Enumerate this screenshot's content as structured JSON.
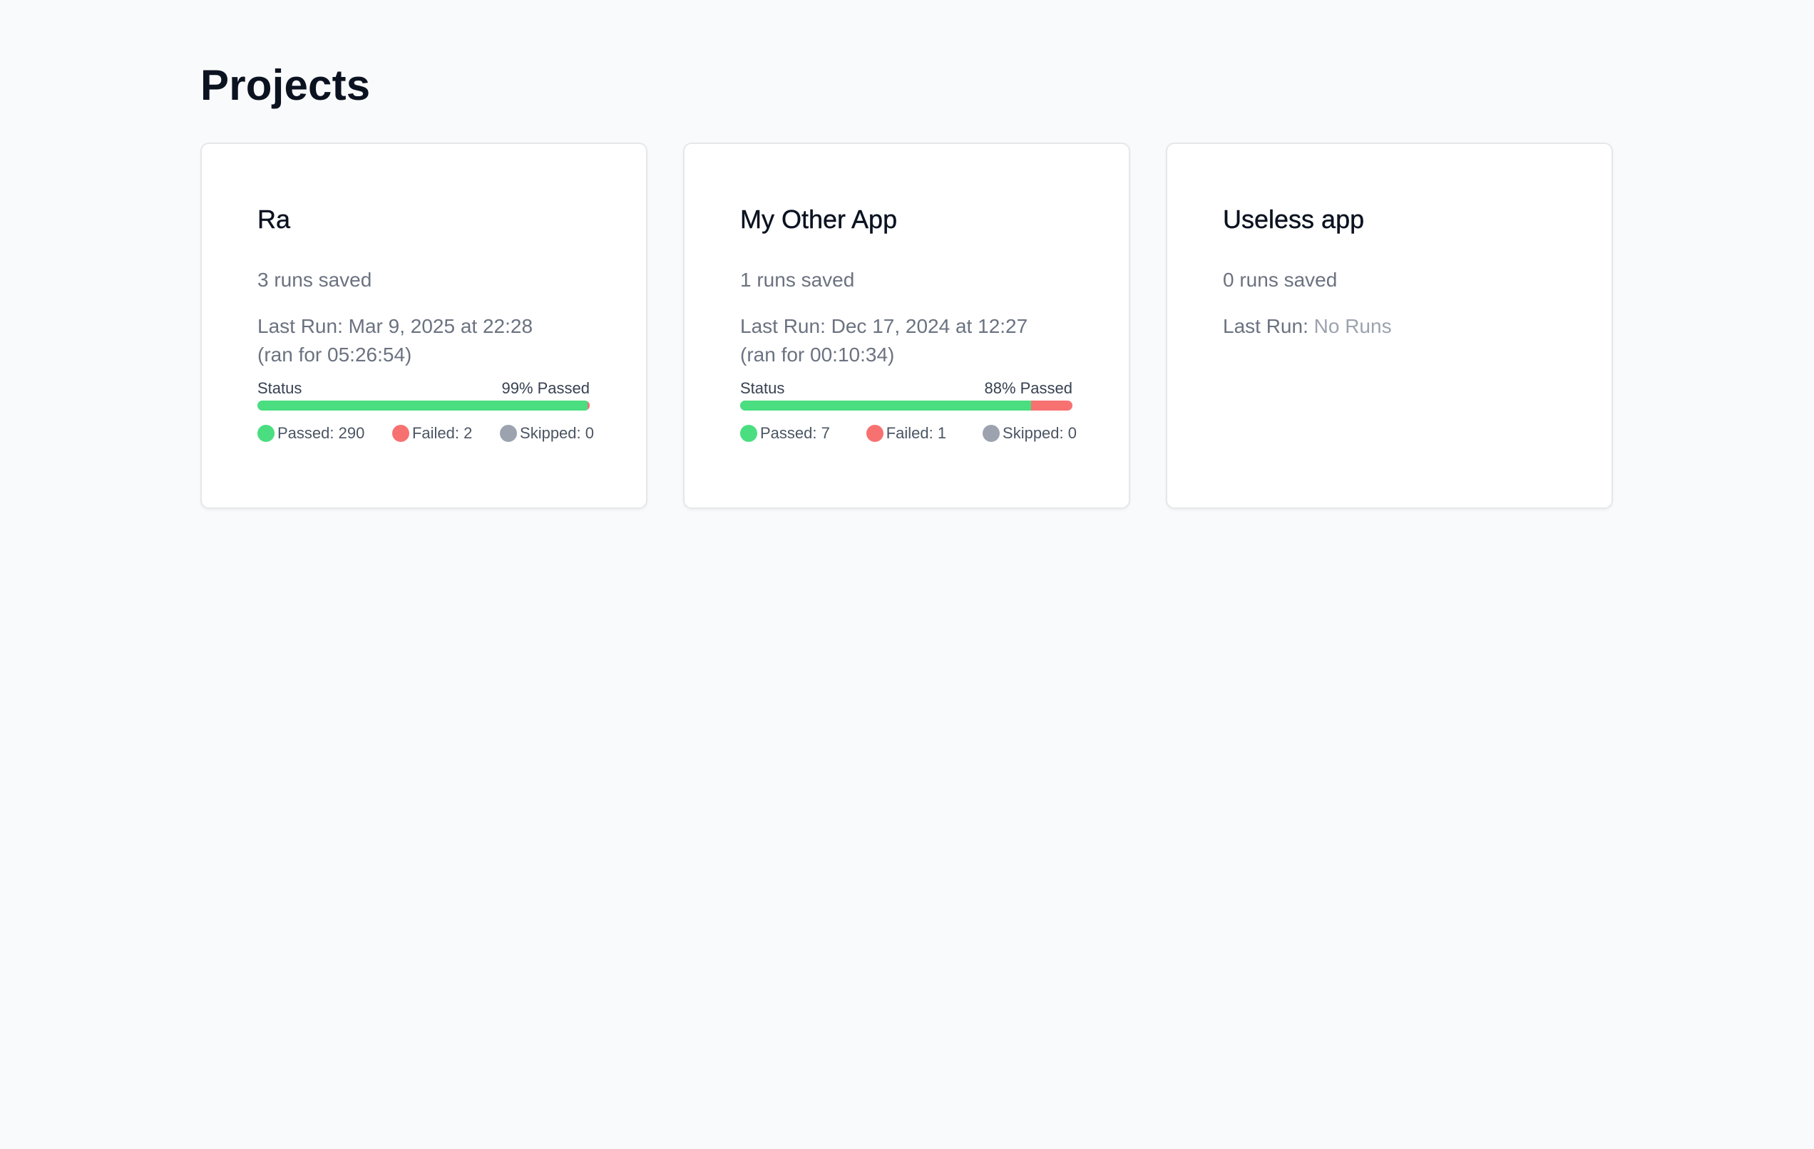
{
  "page": {
    "title": "Projects"
  },
  "colors": {
    "passed": "#4ade80",
    "failed": "#f87171",
    "skipped": "#9ca3af",
    "background": "#f9fafb"
  },
  "projects": [
    {
      "name": "Ra",
      "runs_saved": "3 runs saved",
      "last_run_label": "Last Run: ",
      "last_run_value": "Mar 9, 2025 at 22:28",
      "duration": "(ran for 05:26:54)",
      "status_label": "Status",
      "passed_pct_label": "99% Passed",
      "passed_fraction": 0.993,
      "failed_fraction": 0.007,
      "passed_label": "Passed: 290",
      "failed_label": "Failed: 2",
      "skipped_label": "Skipped: 0"
    },
    {
      "name": "My Other App",
      "runs_saved": "1 runs saved",
      "last_run_label": "Last Run: ",
      "last_run_value": "Dec 17, 2024 at 12:27",
      "duration": "(ran for 00:10:34)",
      "status_label": "Status",
      "passed_pct_label": "88% Passed",
      "passed_fraction": 0.875,
      "failed_fraction": 0.125,
      "passed_label": "Passed: 7",
      "failed_label": "Failed: 1",
      "skipped_label": "Skipped: 0"
    },
    {
      "name": "Useless app",
      "runs_saved": "0 runs saved",
      "last_run_label": "Last Run: ",
      "last_run_value": "No Runs"
    }
  ]
}
